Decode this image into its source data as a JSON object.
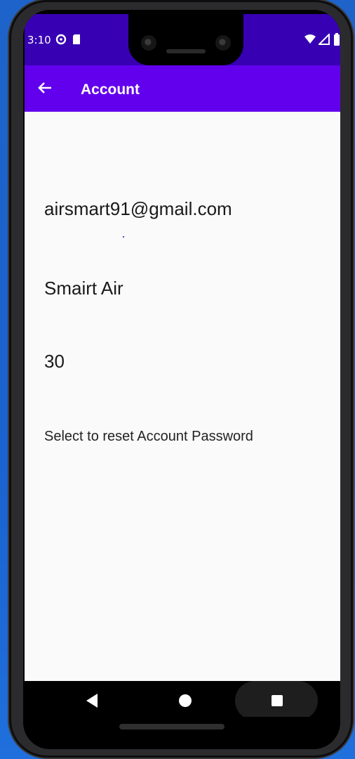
{
  "status_bar": {
    "time": "3:10",
    "icons": [
      "data-saver-icon",
      "sd-card-icon",
      "wifi-icon",
      "signal-icon",
      "battery-icon"
    ]
  },
  "app_bar": {
    "title": "Account",
    "back_icon": "arrow-back-icon"
  },
  "account": {
    "email": "airsmart91@gmail.com",
    "name": "Smairt Air",
    "age": "30",
    "reset_password_label": "Select to reset Account Password"
  },
  "navigation": {
    "icons": [
      "back-triangle-icon",
      "home-circle-icon",
      "recents-square-icon"
    ]
  },
  "colors": {
    "status_bar": "#3700b3",
    "app_bar": "#6200ee",
    "background": "#fafafa"
  }
}
